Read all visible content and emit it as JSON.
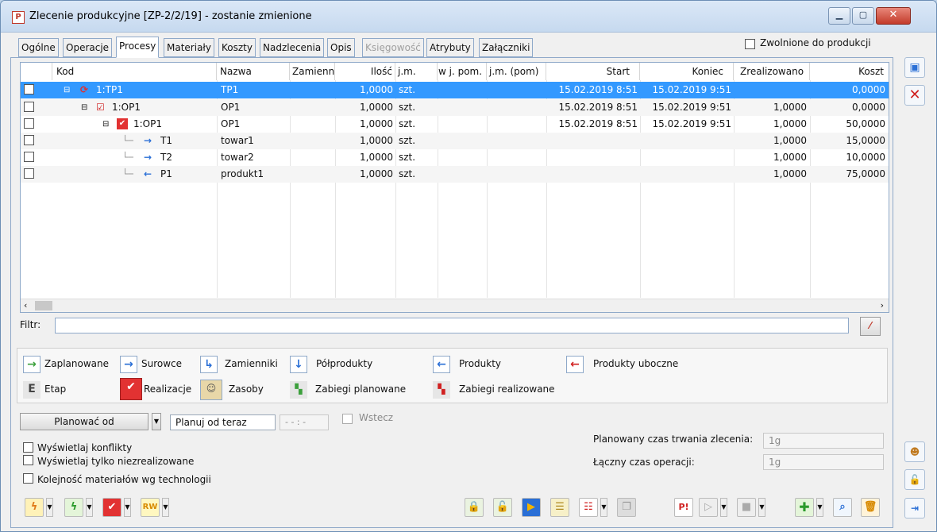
{
  "window": {
    "title": "Zlecenie produkcyjne  [ZP-2/2/19] - zostanie zmienione",
    "icon": "app-p-icon"
  },
  "tabs": [
    "Ogólne",
    "Operacje",
    "Procesy",
    "Materiały",
    "Koszty",
    "Nadzlecenia",
    "Opis",
    "Księgowość",
    "Atrybuty",
    "Załączniki"
  ],
  "active_tab": "Procesy",
  "released_label": "Zwolnione do produkcji",
  "grid": {
    "headers": [
      "Kod",
      "Nazwa",
      "Zamienn",
      "Ilość",
      "j.m.",
      "w j. pom.",
      "j.m. (pom)",
      "Start",
      "Koniec",
      "Zrealizowano",
      "Koszt"
    ],
    "rows": [
      {
        "kod": "1:TP1",
        "nazwa": "TP1",
        "ilosc": "1,0000",
        "jm": "szt.",
        "start": "15.02.2019 8:51",
        "koniec": "15.02.2019 9:51",
        "zreal": "",
        "koszt": "0,0000"
      },
      {
        "kod": "1:OP1",
        "nazwa": "OP1",
        "ilosc": "1,0000",
        "jm": "szt.",
        "start": "15.02.2019 8:51",
        "koniec": "15.02.2019 9:51",
        "zreal": "1,0000",
        "koszt": "0,0000"
      },
      {
        "kod": "1:OP1",
        "nazwa": "OP1",
        "ilosc": "1,0000",
        "jm": "szt.",
        "start": "15.02.2019 8:51",
        "koniec": "15.02.2019 9:51",
        "zreal": "1,0000",
        "koszt": "50,0000"
      },
      {
        "kod": "T1",
        "nazwa": "towar1",
        "ilosc": "1,0000",
        "jm": "szt.",
        "start": "",
        "koniec": "",
        "zreal": "1,0000",
        "koszt": "15,0000"
      },
      {
        "kod": "T2",
        "nazwa": "towar2",
        "ilosc": "1,0000",
        "jm": "szt.",
        "start": "",
        "koniec": "",
        "zreal": "1,0000",
        "koszt": "10,0000"
      },
      {
        "kod": "P1",
        "nazwa": "produkt1",
        "ilosc": "1,0000",
        "jm": "szt.",
        "start": "",
        "koniec": "",
        "zreal": "1,0000",
        "koszt": "75,0000"
      }
    ]
  },
  "filter_label": "Filtr:",
  "legend": {
    "zaplanowane": "Zaplanowane",
    "surowce": "Surowce",
    "zamienniki": "Zamienniki",
    "polprodukty": "Półprodukty",
    "produkty": "Produkty",
    "produkty_uboczne": "Produkty uboczne",
    "etap": "Etap",
    "realizacje": "Realizacje",
    "zasoby": "Zasoby",
    "zabiegi_planowane": "Zabiegi planowane",
    "zabiegi_realizowane": "Zabiegi realizowane"
  },
  "planning": {
    "mode_button": "Planować od",
    "mode_value": "Planuj od teraz",
    "time_value": "- - : -",
    "wstecz": "Wstecz"
  },
  "options": {
    "konflikty": "Wyświetlaj konflikty",
    "niezrealizowane": "Wyświetlaj tylko niezrealizowane",
    "kolejnosc": "Kolejność materiałów wg technologii"
  },
  "durations": {
    "planned_label": "Planowany czas trwania zlecenia:",
    "planned_value": "1g",
    "total_label": "Łączny czas operacji:",
    "total_value": "1g"
  },
  "colors": {
    "accent": "#3399ff",
    "window_border": "#6d8fb5"
  }
}
